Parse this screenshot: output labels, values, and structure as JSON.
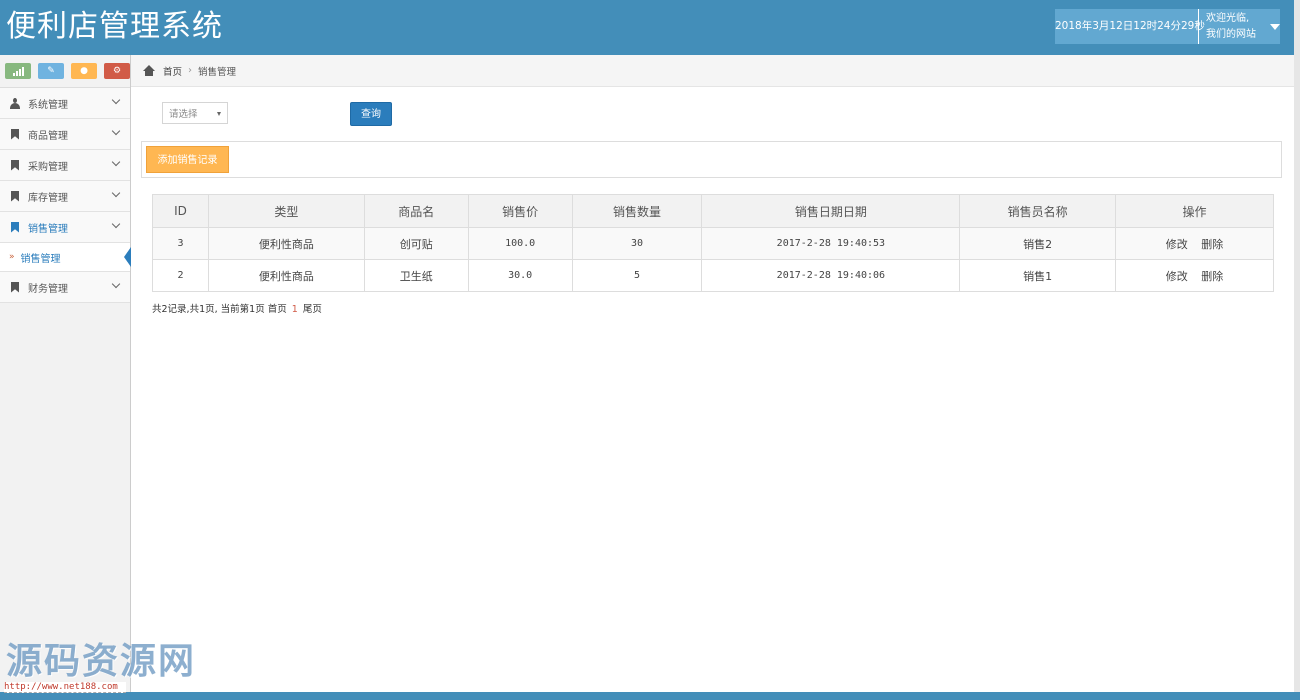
{
  "header": {
    "brand": "便利店管理系统",
    "datetime": "2018年3月12日12时24分29秒",
    "welcome_line1": "欢迎光临,",
    "welcome_line2": "我们的网站"
  },
  "sidebar": {
    "shortcuts": [
      "signal-icon",
      "pencil-icon",
      "group-icon",
      "cogs-icon"
    ],
    "items": [
      {
        "label": "系统管理"
      },
      {
        "label": "商品管理"
      },
      {
        "label": "采购管理"
      },
      {
        "label": "库存管理"
      },
      {
        "label": "销售管理"
      },
      {
        "label": "财务管理"
      }
    ],
    "sub_item": "销售管理"
  },
  "breadcrumb": {
    "home": "首页",
    "current": "销售管理"
  },
  "filters": {
    "select_placeholder": "请选择",
    "query_label": "查询"
  },
  "toolbar": {
    "add_label": "添加销售记录"
  },
  "table": {
    "columns": [
      "ID",
      "类型",
      "商品名",
      "销售价",
      "销售数量",
      "销售日期日期",
      "销售员名称",
      "操作"
    ],
    "rows": [
      {
        "id": "3",
        "type": "便利性商品",
        "name": "创可贴",
        "price": "100.0",
        "qty": "30",
        "date": "2017-2-28 19:40:53",
        "seller": "销售2",
        "edit": "修改",
        "delete": "删除"
      },
      {
        "id": "2",
        "type": "便利性商品",
        "name": "卫生纸",
        "price": "30.0",
        "qty": "5",
        "date": "2017-2-28 19:40:06",
        "seller": "销售1",
        "edit": "修改",
        "delete": "删除"
      }
    ]
  },
  "pager": {
    "summary": "共2记录,共1页, 当前第1页 首页",
    "current_page": "1",
    "last": "尾页"
  },
  "watermark": {
    "text": "源码资源网",
    "url": "http://www.net188.com"
  },
  "colors": {
    "header_bg": "#438eb9",
    "primary": "#2b7dbc",
    "warning": "#ffb752",
    "op_link": "#f89406"
  }
}
